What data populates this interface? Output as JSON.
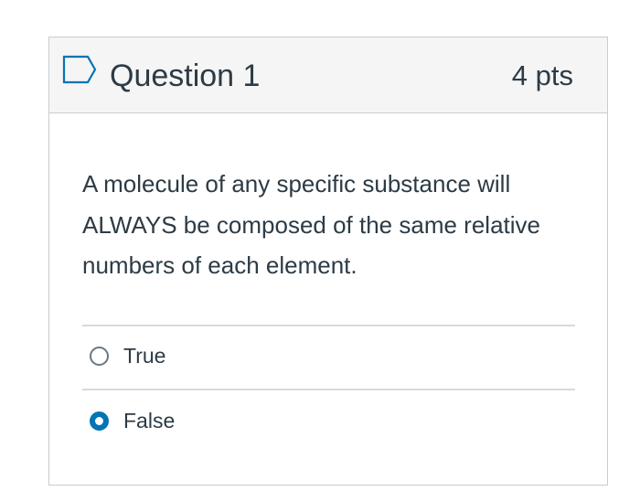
{
  "question": {
    "title": "Question 1",
    "points": "4 pts",
    "text": "A molecule of any specific substance will ALWAYS be composed of the same relative numbers of each element."
  },
  "answers": [
    {
      "label": "True",
      "selected": false
    },
    {
      "label": "False",
      "selected": true
    }
  ],
  "colors": {
    "accent": "#0374b5",
    "text": "#2d3b45",
    "border": "#c7cdd1",
    "header_bg": "#f5f5f5"
  },
  "icons": {
    "header": "bookmark-icon"
  }
}
